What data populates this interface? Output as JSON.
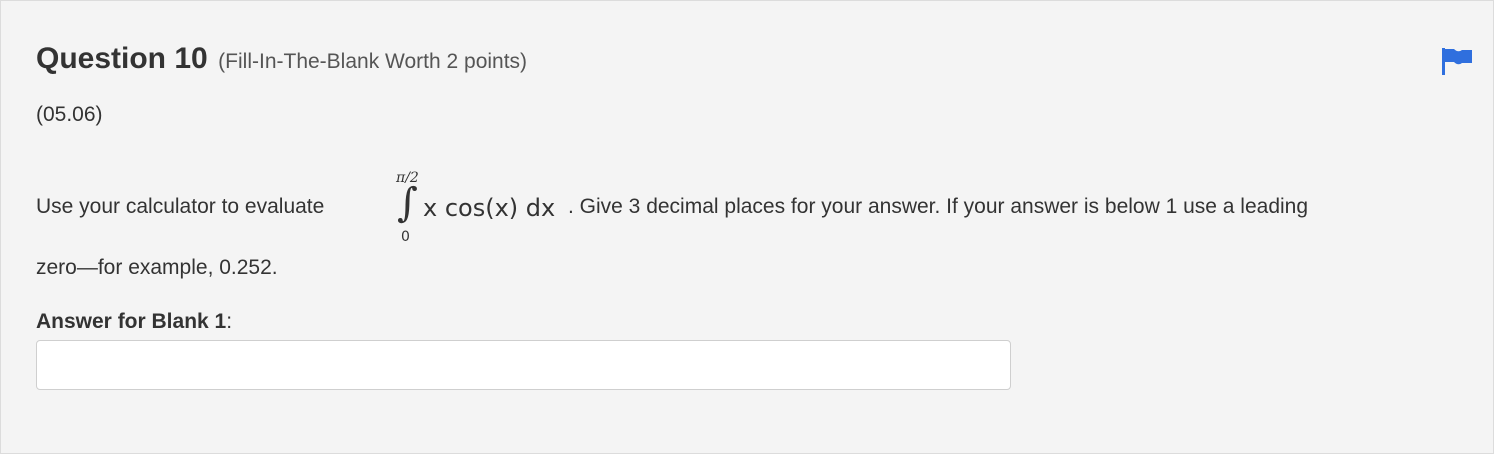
{
  "question": {
    "title": "Question 10",
    "meta": "(Fill-In-The-Blank Worth 2 points)",
    "code": "(05.06)",
    "text_before": "Use your calculator to evaluate",
    "integral": {
      "upper": "π/2",
      "lower": "0",
      "integrand": "x cos(x) dx"
    },
    "text_after": ". Give 3 decimal places for your answer. If your answer is below 1 use a leading",
    "text_line2": "zero—for example, 0.252."
  },
  "answer": {
    "label_bold": "Answer for Blank 1",
    "label_suffix": ":",
    "value": ""
  },
  "flag": {
    "icon": "flag-icon",
    "color": "#2f6fde"
  }
}
